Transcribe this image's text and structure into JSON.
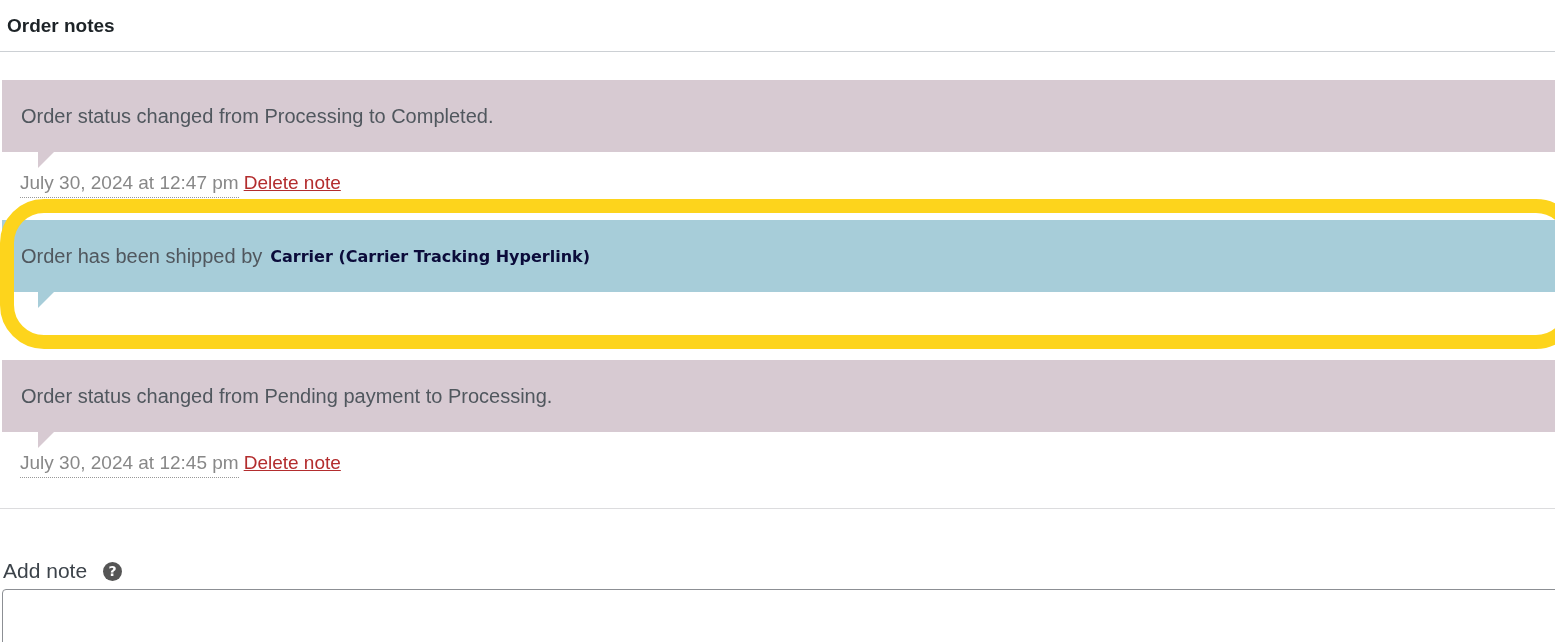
{
  "panel": {
    "title": "Order notes"
  },
  "notes": [
    {
      "kind": "system",
      "text": "Order status changed from Processing to Completed.",
      "date": "July 30, 2024 at 12:47 pm",
      "delete": "Delete note"
    },
    {
      "kind": "customer",
      "text": "Order has been shipped by ",
      "link": "Carrier (Carrier Tracking Hyperlink)"
    },
    {
      "kind": "system",
      "text": "Order status changed from Pending payment to Processing.",
      "date": "July 30, 2024 at 12:45 pm",
      "delete": "Delete note"
    }
  ],
  "add_note": {
    "label": "Add note",
    "help": "?"
  }
}
